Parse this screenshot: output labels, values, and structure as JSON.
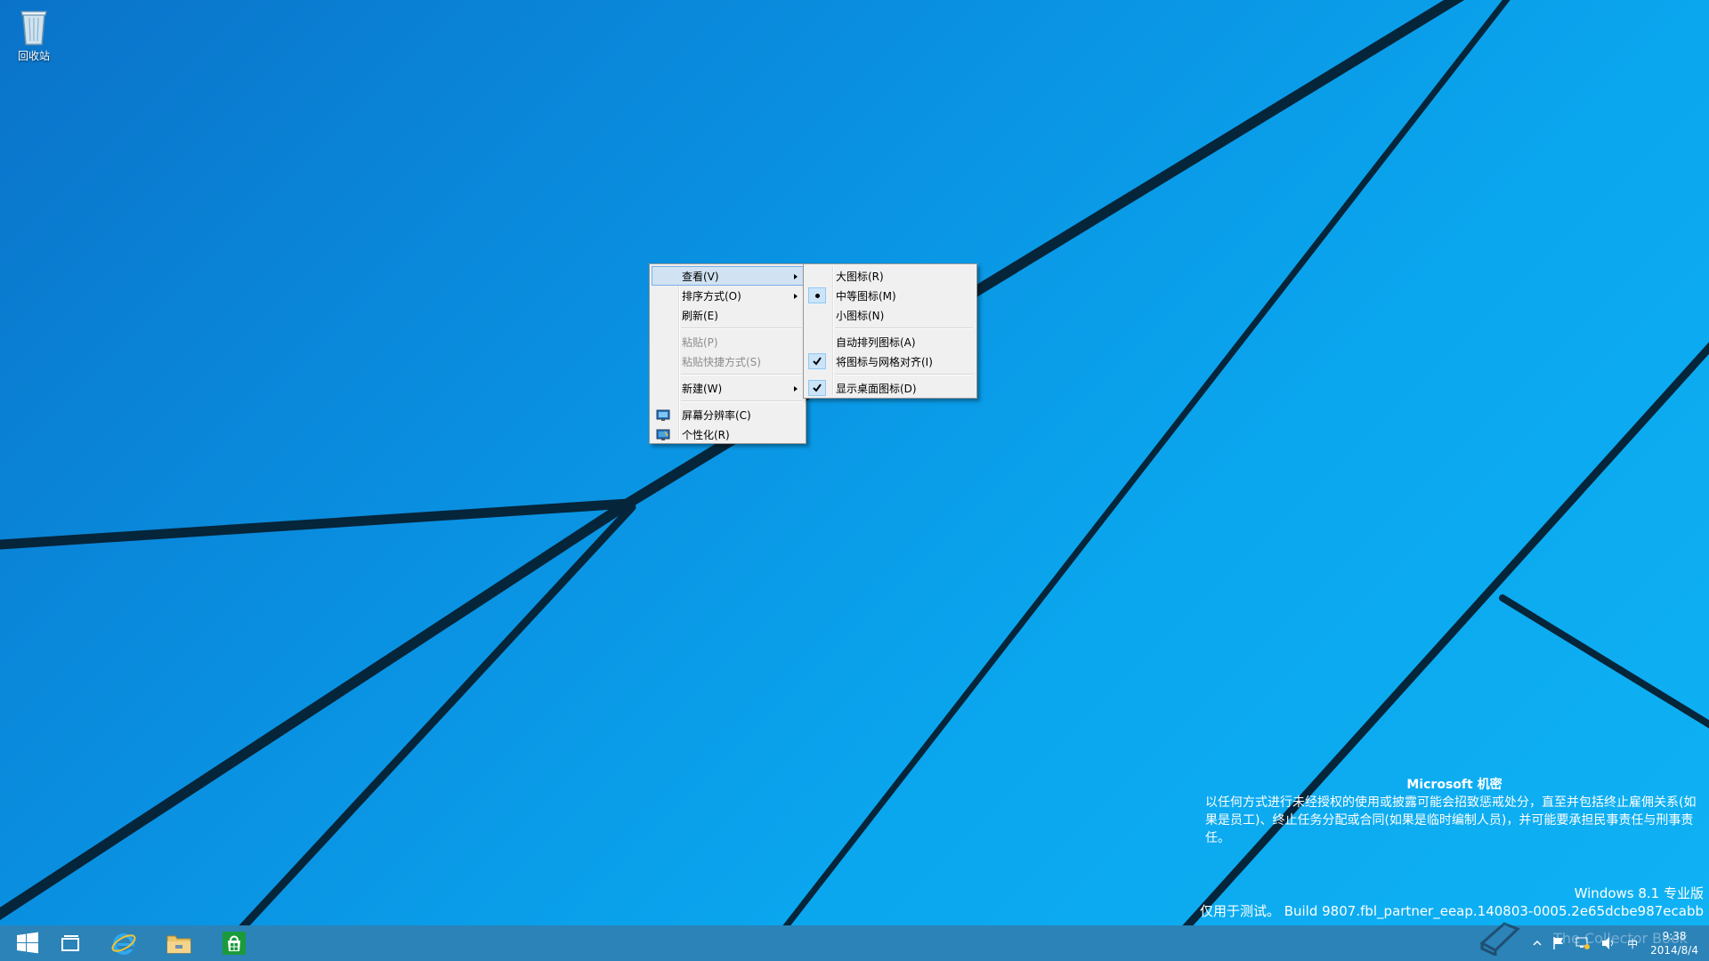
{
  "desktop": {
    "icons": [
      {
        "label": "回收站",
        "icon": "recycle-bin-icon"
      }
    ]
  },
  "context_menu": {
    "items": [
      {
        "label": "查看(V)",
        "submenu": true,
        "highlighted": true
      },
      {
        "label": "排序方式(O)",
        "submenu": true
      },
      {
        "label": "刷新(E)"
      },
      {
        "label": "粘贴(P)",
        "disabled": true
      },
      {
        "label": "粘贴快捷方式(S)",
        "disabled": true
      },
      {
        "label": "新建(W)",
        "submenu": true
      },
      {
        "label": "屏幕分辨率(C)",
        "icon": "display-resolution-icon"
      },
      {
        "label": "个性化(R)",
        "icon": "personalize-icon"
      }
    ]
  },
  "view_submenu": {
    "items": [
      {
        "label": "大图标(R)"
      },
      {
        "label": "中等图标(M)",
        "marker": "radio-dot"
      },
      {
        "label": "小图标(N)"
      },
      {
        "label": "自动排列图标(A)"
      },
      {
        "label": "将图标与网格对齐(I)",
        "marker": "checkmark"
      },
      {
        "label": "显示桌面图标(D)",
        "marker": "checkmark"
      }
    ]
  },
  "watermark": {
    "title": "Microsoft 机密",
    "body": "以任何方式进行未经授权的使用或披露可能会招致惩戒处分，直至并包括终止雇佣关系(如果是员工)、终止任务分配或合同(如果是临时编制人员)，并可能要承担民事责任与刑事责任。",
    "edition": "Windows 8.1 专业版",
    "build": "仅用于测试。 Build 9807.fbl_partner_eeap.140803-0005.2e65dcbe987ecabb"
  },
  "taskbar": {
    "buttons": [
      "start-button-icon",
      "task-view-icon",
      "internet-explorer-icon",
      "file-explorer-icon",
      "store-icon"
    ],
    "tray": {
      "ime": "中",
      "time": "9:38",
      "date": "2014/8/4"
    }
  },
  "overlay": {
    "site_watermark": "The Collector Book"
  },
  "colors": {
    "desktop_blue": "#0a9ae8",
    "menu_bg": "#f0f0f0",
    "menu_highlight": "#d1e2f2",
    "taskbar": "#2b83b8"
  }
}
